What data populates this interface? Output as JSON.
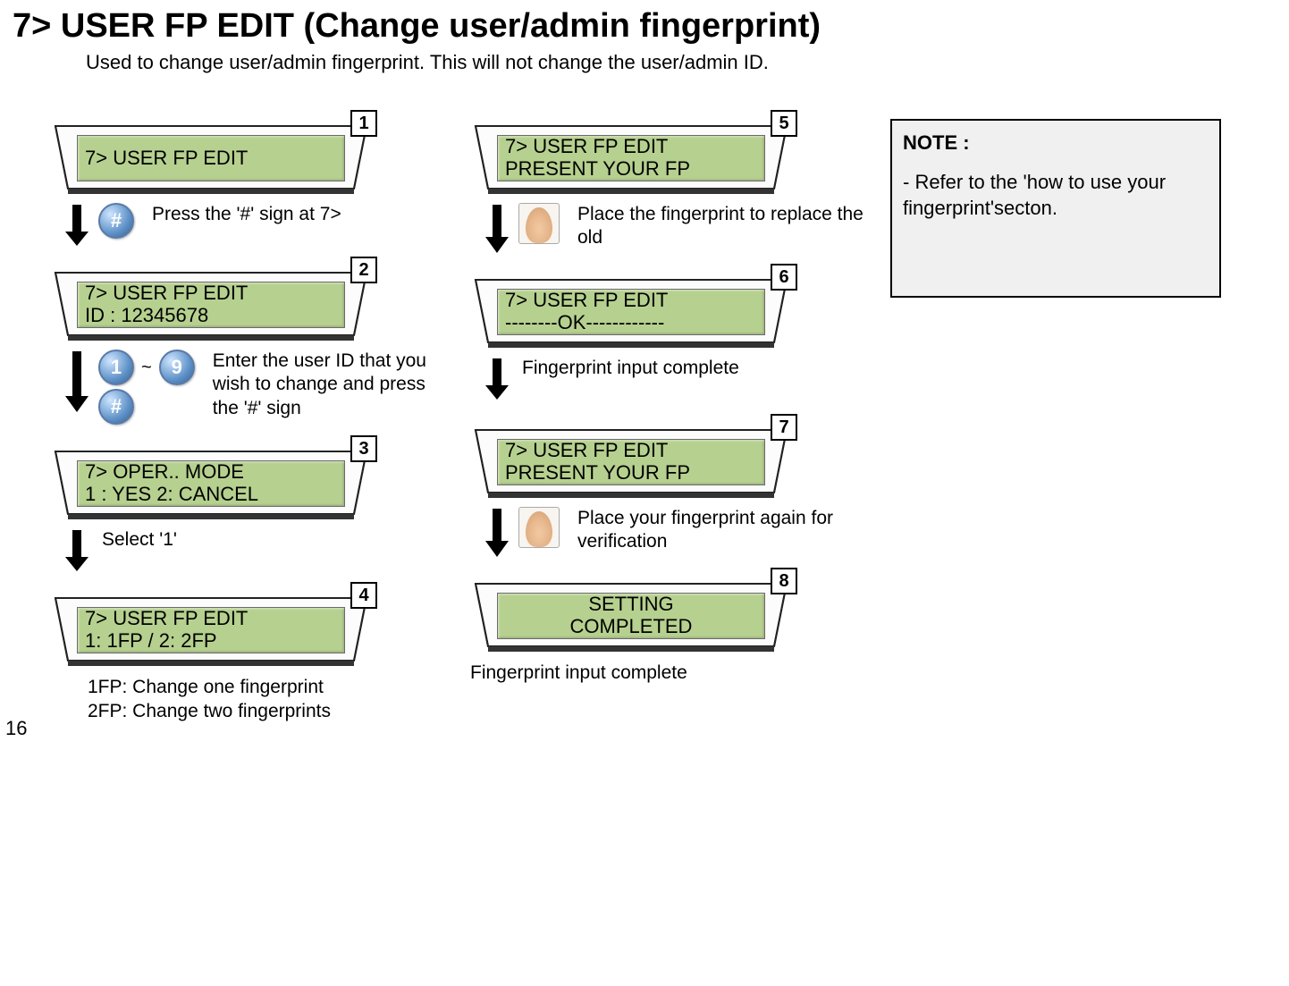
{
  "page": {
    "title": "7> USER FP EDIT (Change user/admin fingerprint)",
    "subtitle": "Used to change user/admin fingerprint. This will not change the user/admin ID.",
    "page_number": "16"
  },
  "note": {
    "title": "NOTE :",
    "body": "- Refer to the 'how to use your fingerprint'secton."
  },
  "steps": {
    "s1": {
      "num": "1",
      "line1": "7> USER FP EDIT",
      "action": "Press the '#' sign at 7>",
      "key": "#"
    },
    "s2": {
      "num": "2",
      "line1": "7> USER FP EDIT",
      "line2": "ID : 12345678",
      "action": "Enter the user ID that you wish to change and press the '#' sign",
      "key1": "1",
      "tilde": "~",
      "key9": "9",
      "keyhash": "#"
    },
    "s3": {
      "num": "3",
      "line1": "7> OPER..  MODE",
      "line2": " 1 : YES     2: CANCEL",
      "action": "Select '1'"
    },
    "s4": {
      "num": "4",
      "line1": "7> USER FP EDIT",
      "line2": "1: 1FP    /    2: 2FP",
      "caption": "1FP: Change one fingerprint\n2FP: Change two fingerprints"
    },
    "s5": {
      "num": "5",
      "line1": "7> USER FP EDIT",
      "line2": "PRESENT YOUR FP",
      "action": "Place the fingerprint to replace the old"
    },
    "s6": {
      "num": "6",
      "line1": "7> USER FP EDIT",
      "line2": "--------OK------------",
      "action": "Fingerprint input complete"
    },
    "s7": {
      "num": "7",
      "line1": "7> USER FP EDIT",
      "line2": "PRESENT YOUR FP",
      "action": "Place your fingerprint again for verification"
    },
    "s8": {
      "num": "8",
      "line1": "SETTING",
      "line2": "COMPLETED",
      "caption": "Fingerprint input complete"
    }
  }
}
